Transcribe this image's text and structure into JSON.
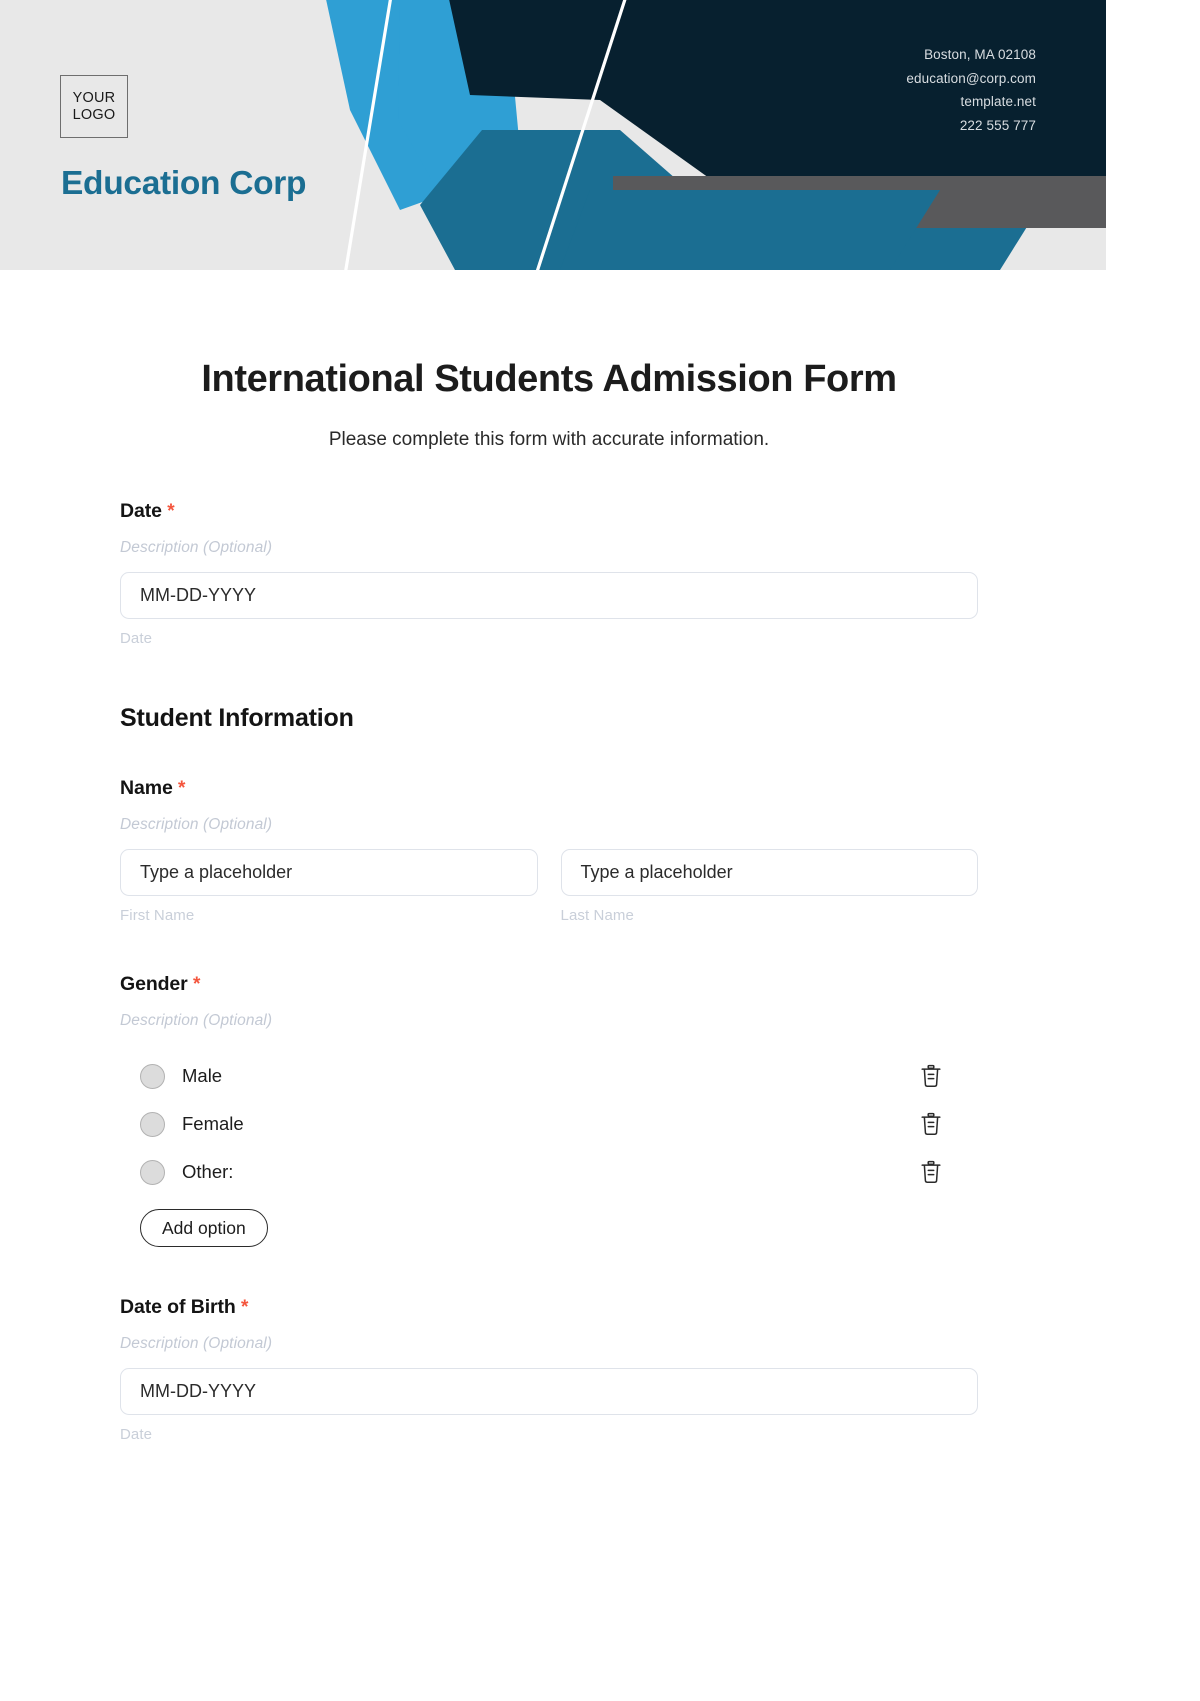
{
  "header": {
    "logo": {
      "line1": "YOUR",
      "line2": "LOGO"
    },
    "company_name": "Education Corp",
    "contact": {
      "address": "Boston, MA 02108",
      "email": "education@corp.com",
      "website": "template.net",
      "phone": "222 555 777"
    },
    "colors": {
      "background": "#e8e8e8",
      "navy": "#07202f",
      "light_blue": "#2f9fd4",
      "mid_teal": "#1b6e92",
      "gray_bar": "#59595b",
      "brand_text": "#1b6e92"
    }
  },
  "form": {
    "title": "International Students Admission Form",
    "subtitle": "Please complete this form with accurate information.",
    "required_marker": "*",
    "required_color": "#f4553d",
    "date_field": {
      "label": "Date",
      "description": "Description (Optional)",
      "value": "MM-DD-YYYY",
      "helper": "Date"
    },
    "section_student": {
      "heading": "Student Information",
      "name_field": {
        "label": "Name",
        "description": "Description (Optional)",
        "first": {
          "value": "Type a placeholder",
          "helper": "First Name"
        },
        "last": {
          "value": "Type a placeholder",
          "helper": "Last Name"
        }
      },
      "gender_field": {
        "label": "Gender",
        "description": "Description (Optional)",
        "options": [
          {
            "label": "Male",
            "delete_icon": "trash-icon"
          },
          {
            "label": "Female",
            "delete_icon": "trash-icon"
          },
          {
            "label": "Other:",
            "delete_icon": "trash-icon"
          }
        ],
        "add_option_label": "Add option"
      },
      "dob_field": {
        "label": "Date of Birth",
        "description": "Description (Optional)",
        "value": "MM-DD-YYYY",
        "helper": "Date"
      }
    }
  }
}
